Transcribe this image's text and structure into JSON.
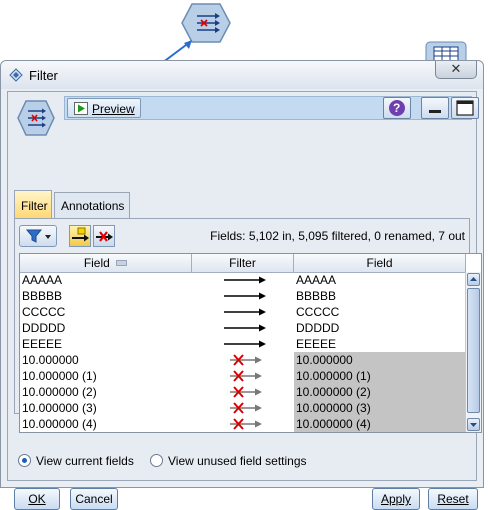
{
  "window": {
    "title": "Filter",
    "close_glyph": "✕"
  },
  "toolbar": {
    "preview_label": "Preview",
    "help_glyph": "?"
  },
  "tabs": [
    {
      "label": "Filter",
      "active": true
    },
    {
      "label": "Annotations",
      "active": false
    }
  ],
  "summary": "Fields: 5,102 in, 5,095 filtered, 0 renamed, 7 out",
  "grid": {
    "headers": [
      "Field",
      "Filter",
      "Field"
    ],
    "rows": [
      {
        "in": "AAAAA",
        "out": "AAAAA",
        "filtered": false
      },
      {
        "in": "BBBBB",
        "out": "BBBBB",
        "filtered": false
      },
      {
        "in": "CCCCC",
        "out": "CCCCC",
        "filtered": false
      },
      {
        "in": "DDDDD",
        "out": "DDDDD",
        "filtered": false
      },
      {
        "in": "EEEEE",
        "out": "EEEEE",
        "filtered": false
      },
      {
        "in": "10.000000",
        "out": "10.000000",
        "filtered": true
      },
      {
        "in": "10.000000 (1)",
        "out": "10.000000 (1)",
        "filtered": true
      },
      {
        "in": "10.000000 (2)",
        "out": "10.000000 (2)",
        "filtered": true
      },
      {
        "in": "10.000000 (3)",
        "out": "10.000000 (3)",
        "filtered": true
      },
      {
        "in": "10.000000 (4)",
        "out": "10.000000 (4)",
        "filtered": true
      }
    ]
  },
  "view_options": {
    "current": "View current fields",
    "unused": "View unused field settings",
    "selected": "current"
  },
  "buttons": {
    "ok": "OK",
    "cancel": "Cancel",
    "apply": "Apply",
    "reset": "Reset"
  },
  "colors": {
    "accent": "#1c5fb8",
    "filtered_cell": "#c4c4c4",
    "cross": "#e00000",
    "tab_active": "#ffd874"
  }
}
